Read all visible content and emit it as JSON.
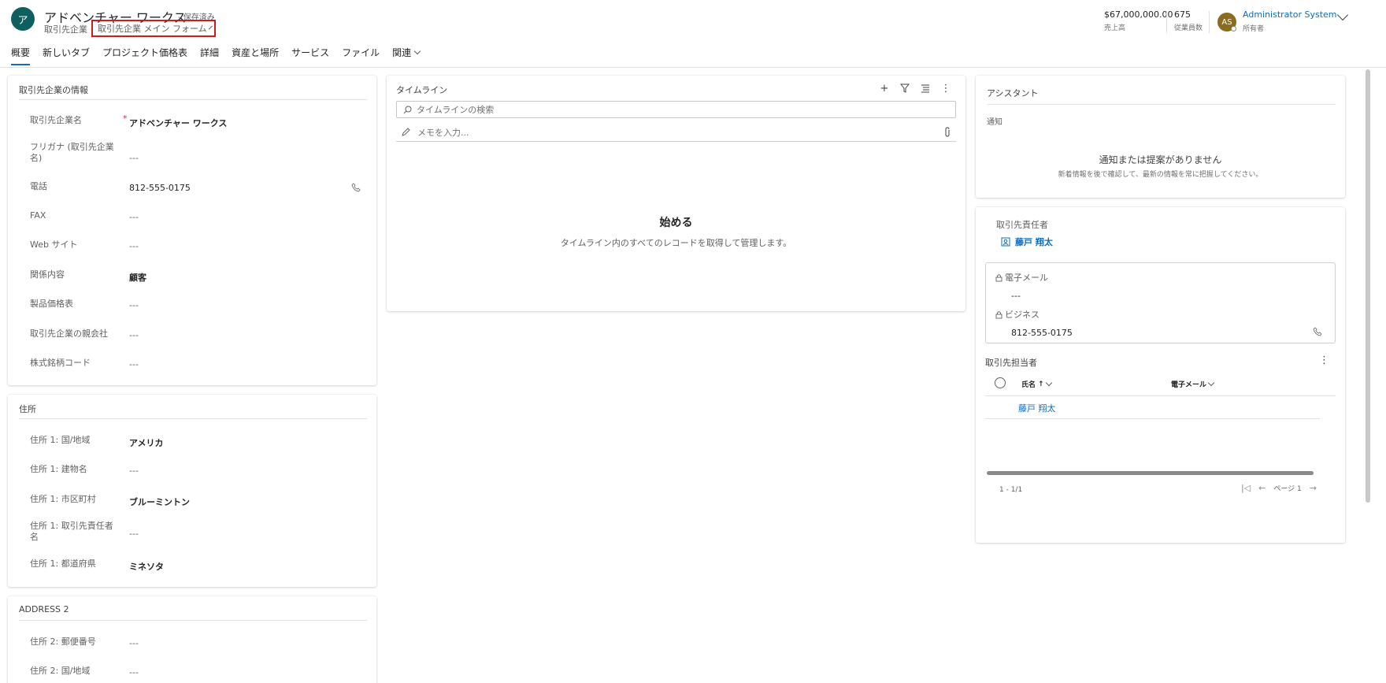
{
  "header": {
    "avatar_initial": "ア",
    "record_title": "アドベンチャー ワークス",
    "saved_status": "- 保存済み",
    "entity_name": "取引先企業",
    "form_selector": "取引先企業 メイン フォーム",
    "kpis": [
      {
        "value": "$67,000,000.00",
        "label": "売上高"
      },
      {
        "value": "675",
        "label": "従業員数"
      }
    ],
    "owner": {
      "initials": "AS",
      "name": "Administrator System",
      "role": "所有者"
    }
  },
  "tabs": [
    {
      "label": "概要",
      "active": true
    },
    {
      "label": "新しいタブ",
      "active": false
    },
    {
      "label": "プロジェクト価格表",
      "active": false
    },
    {
      "label": "詳細",
      "active": false
    },
    {
      "label": "資産と場所",
      "active": false
    },
    {
      "label": "サービス",
      "active": false
    },
    {
      "label": "ファイル",
      "active": false
    },
    {
      "label": "関連",
      "active": false
    }
  ],
  "account_info": {
    "title": "取引先企業の情報",
    "fields": [
      {
        "label": "取引先企業名",
        "value": "アドベンチャー ワークス",
        "required": true
      },
      {
        "label": "フリガナ (取引先企業名)",
        "value": "---"
      },
      {
        "label": "電話",
        "value": "812-555-0175",
        "phone": true
      },
      {
        "label": "FAX",
        "value": "---"
      },
      {
        "label": "Web サイト",
        "value": "---"
      },
      {
        "label": "関係内容",
        "value": "顧客"
      },
      {
        "label": "製品価格表",
        "value": "---"
      },
      {
        "label": "取引先企業の親会社",
        "value": "---"
      },
      {
        "label": "株式銘柄コード",
        "value": "---"
      }
    ]
  },
  "address1": {
    "title": "住所",
    "fields": [
      {
        "label": "住所 1: 国/地域",
        "value": "アメリカ"
      },
      {
        "label": "住所 1: 建物名",
        "value": "---"
      },
      {
        "label": "住所 1: 市区町村",
        "value": "ブルーミントン"
      },
      {
        "label": "住所 1: 取引先責任者名",
        "value": "---"
      },
      {
        "label": "住所 1: 都道府県",
        "value": "ミネソタ"
      }
    ]
  },
  "address2": {
    "title": "ADDRESS 2",
    "fields": [
      {
        "label": "住所 2: 郵便番号",
        "value": "---"
      },
      {
        "label": "住所 2: 国/地域",
        "value": "---"
      }
    ]
  },
  "timeline": {
    "title": "タイムライン",
    "search_placeholder": "タイムラインの検索",
    "note_placeholder": "メモを入力...",
    "empty_title": "始める",
    "empty_desc": "タイムライン内のすべてのレコードを取得して管理します。"
  },
  "assistant": {
    "title": "アシスタント",
    "subtitle": "通知",
    "empty_msg": "通知または提案がありません",
    "hint": "新着情報を後で確認して、最新の情報を常に把握してください。"
  },
  "primary_contact": {
    "label": "取引先責任者",
    "name": "藤戸 翔太",
    "email_label": "電子メール",
    "email_value": "---",
    "business_label": "ビジネス",
    "business_value": "812-555-0175"
  },
  "contacts_grid": {
    "title": "取引先担当者",
    "col_name": "氏名",
    "col_email": "電子メール",
    "rows": [
      {
        "name": "藤戸 翔太"
      }
    ],
    "count": "1 - 1/1",
    "page_label": "ページ 1"
  }
}
